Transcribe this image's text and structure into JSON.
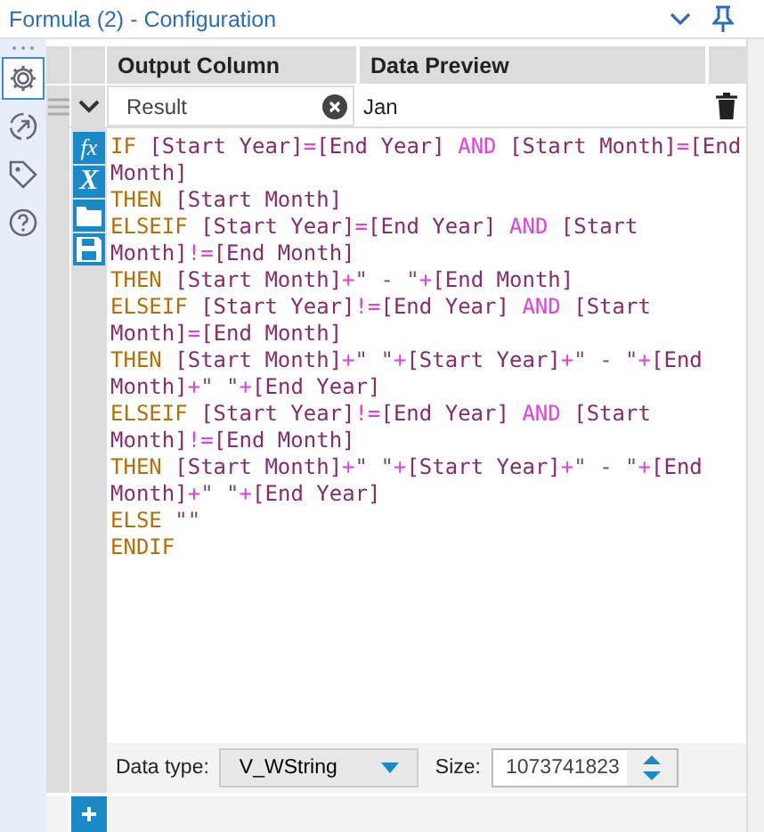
{
  "window": {
    "title": "Formula (2) - Configuration"
  },
  "tools": [
    {
      "kind": "function",
      "label": "fx"
    },
    {
      "kind": "variable",
      "label": "X"
    },
    {
      "kind": "open"
    },
    {
      "kind": "save"
    }
  ],
  "rail": [
    {
      "kind": "gear",
      "selected": true
    },
    {
      "kind": "connect",
      "selected": false
    },
    {
      "kind": "tag",
      "selected": false
    },
    {
      "kind": "help",
      "selected": false
    }
  ],
  "table": {
    "columns": [
      "Output Column",
      "Data Preview"
    ],
    "row": {
      "expanded": true,
      "output_column": "Result",
      "preview": "Jan",
      "formula_lines": [
        [
          {
            "kind": "keyword",
            "text": "IF "
          },
          {
            "kind": "field",
            "text": "[Start Year]"
          },
          {
            "kind": "operator",
            "text": "="
          },
          {
            "kind": "field",
            "text": "[End Year]"
          },
          {
            "kind": "operator",
            "text": " AND "
          },
          {
            "kind": "field",
            "text": "[Start Month]"
          },
          {
            "kind": "operator",
            "text": "="
          },
          {
            "kind": "field",
            "text": "[End"
          }
        ],
        [
          {
            "kind": "field",
            "text": "Month]"
          }
        ],
        [
          {
            "kind": "keyword",
            "text": "THEN "
          },
          {
            "kind": "field",
            "text": "[Start Month]"
          }
        ],
        [
          {
            "kind": "keyword",
            "text": "ELSEIF "
          },
          {
            "kind": "field",
            "text": "[Start Year]"
          },
          {
            "kind": "operator",
            "text": "="
          },
          {
            "kind": "field",
            "text": "[End Year]"
          },
          {
            "kind": "operator",
            "text": " AND "
          },
          {
            "kind": "field",
            "text": "[Start"
          }
        ],
        [
          {
            "kind": "field",
            "text": "Month]"
          },
          {
            "kind": "operator",
            "text": "!="
          },
          {
            "kind": "field",
            "text": "[End Month]"
          }
        ],
        [
          {
            "kind": "keyword",
            "text": "THEN "
          },
          {
            "kind": "field",
            "text": "[Start Month]"
          },
          {
            "kind": "operator",
            "text": "+"
          },
          {
            "kind": "string",
            "text": "\" - \""
          },
          {
            "kind": "operator",
            "text": "+"
          },
          {
            "kind": "field",
            "text": "[End Month]"
          }
        ],
        [
          {
            "kind": "keyword",
            "text": "ELSEIF "
          },
          {
            "kind": "field",
            "text": "[Start Year]"
          },
          {
            "kind": "operator",
            "text": "!="
          },
          {
            "kind": "field",
            "text": "[End Year]"
          },
          {
            "kind": "operator",
            "text": " AND "
          },
          {
            "kind": "field",
            "text": "[Start"
          }
        ],
        [
          {
            "kind": "field",
            "text": "Month]"
          },
          {
            "kind": "operator",
            "text": "="
          },
          {
            "kind": "field",
            "text": "[End Month]"
          }
        ],
        [
          {
            "kind": "keyword",
            "text": "THEN "
          },
          {
            "kind": "field",
            "text": "[Start Month]"
          },
          {
            "kind": "operator",
            "text": "+"
          },
          {
            "kind": "string",
            "text": "\" \""
          },
          {
            "kind": "operator",
            "text": "+"
          },
          {
            "kind": "field",
            "text": "[Start Year]"
          },
          {
            "kind": "operator",
            "text": "+"
          },
          {
            "kind": "string",
            "text": "\" - \""
          },
          {
            "kind": "operator",
            "text": "+"
          },
          {
            "kind": "field",
            "text": "[End"
          }
        ],
        [
          {
            "kind": "field",
            "text": "Month]"
          },
          {
            "kind": "operator",
            "text": "+"
          },
          {
            "kind": "string",
            "text": "\" \""
          },
          {
            "kind": "operator",
            "text": "+"
          },
          {
            "kind": "field",
            "text": "[End Year]"
          }
        ],
        [
          {
            "kind": "keyword",
            "text": "ELSEIF "
          },
          {
            "kind": "field",
            "text": "[Start Year]"
          },
          {
            "kind": "operator",
            "text": "!="
          },
          {
            "kind": "field",
            "text": "[End Year]"
          },
          {
            "kind": "operator",
            "text": " AND "
          },
          {
            "kind": "field",
            "text": "[Start"
          }
        ],
        [
          {
            "kind": "field",
            "text": "Month]"
          },
          {
            "kind": "operator",
            "text": "!="
          },
          {
            "kind": "field",
            "text": "[End Month]"
          }
        ],
        [
          {
            "kind": "keyword",
            "text": "THEN "
          },
          {
            "kind": "field",
            "text": "[Start Month]"
          },
          {
            "kind": "operator",
            "text": "+"
          },
          {
            "kind": "string",
            "text": "\" \""
          },
          {
            "kind": "operator",
            "text": "+"
          },
          {
            "kind": "field",
            "text": "[Start Year]"
          },
          {
            "kind": "operator",
            "text": "+"
          },
          {
            "kind": "string",
            "text": "\" - \""
          },
          {
            "kind": "operator",
            "text": "+"
          },
          {
            "kind": "field",
            "text": "[End"
          }
        ],
        [
          {
            "kind": "field",
            "text": "Month]"
          },
          {
            "kind": "operator",
            "text": "+"
          },
          {
            "kind": "string",
            "text": "\" \""
          },
          {
            "kind": "operator",
            "text": "+"
          },
          {
            "kind": "field",
            "text": "[End Year]"
          }
        ],
        [
          {
            "kind": "keyword",
            "text": "ELSE "
          },
          {
            "kind": "string",
            "text": "\"\""
          }
        ],
        [
          {
            "kind": "keyword",
            "text": "ENDIF"
          }
        ]
      ],
      "data_type_label": "Data type:",
      "data_type": "V_WString",
      "size_label": "Size:",
      "size": "1073741823"
    }
  }
}
